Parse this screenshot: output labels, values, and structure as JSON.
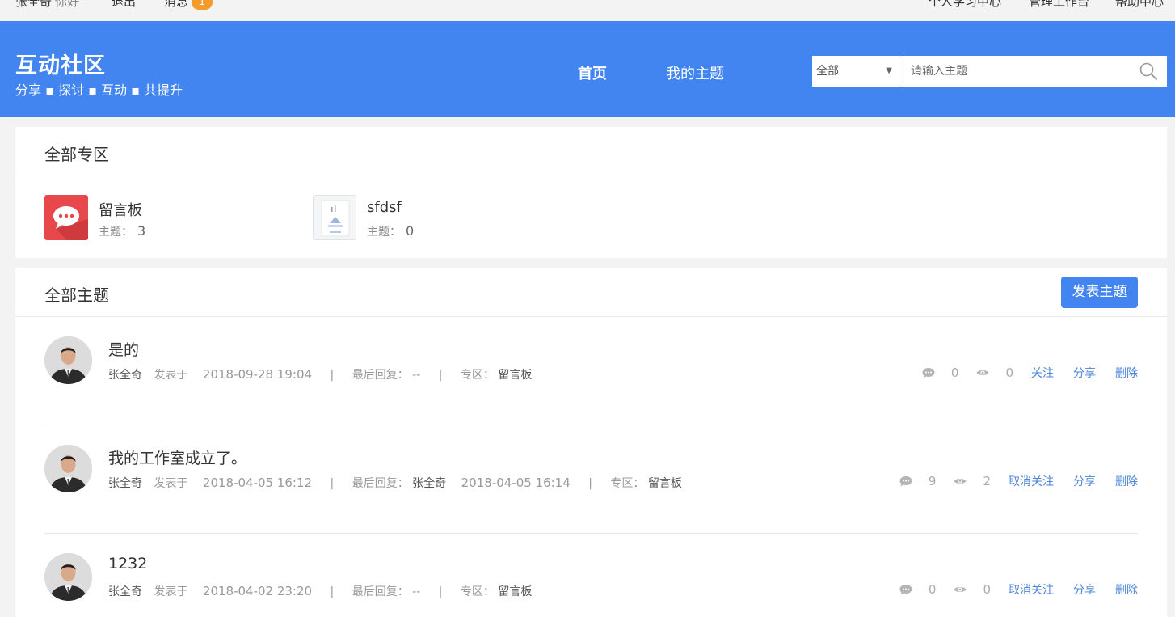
{
  "topbar": {
    "user_name": "张全奇",
    "greeting": "你好",
    "logout": "退出",
    "messages": "消息",
    "message_count": "1",
    "study_center": "个人学习中心",
    "admin": "管理工作台",
    "help": "帮助中心"
  },
  "header": {
    "title": "互动社区",
    "subtitle": "分享 ▪ 探讨 ▪ 互动 ▪ 共提升",
    "nav_home": "首页",
    "nav_my": "我的主题",
    "search_scope": "全部",
    "search_placeholder": "请输入主题"
  },
  "zones_panel": {
    "title": "全部专区",
    "zones": [
      {
        "name": "留言板",
        "count_label": "主题：",
        "count": "3"
      },
      {
        "name": "sfdsf",
        "count_label": "主题：",
        "count": "0"
      }
    ]
  },
  "topics_panel": {
    "title": "全部主题",
    "post_button": "发表主题",
    "topics": [
      {
        "title": "是的",
        "author": "张全奇",
        "posted_label": "发表于",
        "posted_at": "2018-09-28 19:04",
        "last_reply_label": "最后回复：",
        "last_reply_user": "",
        "last_reply_at": "--",
        "zone_label": "专区：",
        "zone": "留言板",
        "comments": "0",
        "views": "0",
        "follow": "关注",
        "share": "分享",
        "delete": "删除"
      },
      {
        "title": "我的工作室成立了。",
        "author": "张全奇",
        "posted_label": "发表于",
        "posted_at": "2018-04-05 16:12",
        "last_reply_label": "最后回复：",
        "last_reply_user": "张全奇",
        "last_reply_at": "2018-04-05 16:14",
        "zone_label": "专区：",
        "zone": "留言板",
        "comments": "9",
        "views": "2",
        "follow": "取消关注",
        "share": "分享",
        "delete": "删除"
      },
      {
        "title": "1232",
        "author": "张全奇",
        "posted_label": "发表于",
        "posted_at": "2018-04-02 23:20",
        "last_reply_label": "最后回复：",
        "last_reply_user": "",
        "last_reply_at": "--",
        "zone_label": "专区：",
        "zone": "留言板",
        "comments": "0",
        "views": "0",
        "follow": "取消关注",
        "share": "分享",
        "delete": "删除"
      }
    ]
  },
  "colors": {
    "primary": "#4285f0",
    "link": "#4d86d9",
    "badge": "#f39b2b",
    "zone_icon": "#e8474b"
  }
}
